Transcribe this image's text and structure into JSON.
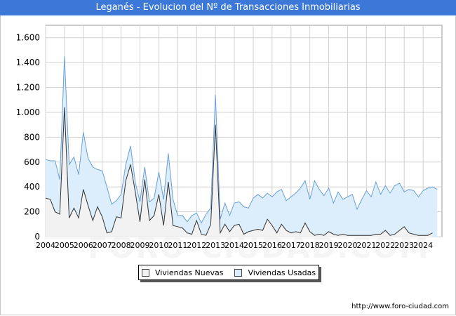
{
  "title": "Leganés - Evolucion del Nº de Transacciones Inmobiliarias",
  "footer": "http://www.foro-ciudad.com",
  "watermark": "FORO-CIUDAD.COM",
  "colors": {
    "title_bar": "#3c78d8",
    "nuevas_fill": "#f2f2f2",
    "nuevas_line": "#333333",
    "usadas_fill": "#dceefc",
    "usadas_line": "#6a9fd8"
  },
  "chart_data": {
    "type": "area",
    "title": "Leganés - Evolucion del Nº de Transacciones Inmobiliarias",
    "x_start": 2004,
    "x_step_quarter": 0.25,
    "x_ticks": [
      "2004",
      "2005",
      "2006",
      "2007",
      "2008",
      "2009",
      "2010",
      "2011",
      "2012",
      "2013",
      "2014",
      "2015",
      "2016",
      "2017",
      "2018",
      "2019",
      "2020",
      "2021",
      "2022",
      "2023",
      "2024"
    ],
    "y_ticks": [
      "0",
      "200",
      "400",
      "600",
      "800",
      "1.000",
      "1.200",
      "1.400",
      "1.600"
    ],
    "ylim": [
      0,
      1700
    ],
    "grid": true,
    "legend_position": "bottom-center",
    "series": [
      {
        "name": "Viviendas Nuevas",
        "values": [
          310,
          300,
          200,
          180,
          1040,
          150,
          230,
          150,
          380,
          250,
          130,
          240,
          160,
          30,
          40,
          160,
          150,
          450,
          580,
          360,
          120,
          460,
          130,
          170,
          340,
          90,
          440,
          90,
          80,
          70,
          30,
          20,
          130,
          20,
          10,
          100,
          900,
          30,
          100,
          40,
          90,
          100,
          20,
          40,
          50,
          60,
          50,
          140,
          90,
          30,
          100,
          50,
          30,
          40,
          30,
          110,
          40,
          10,
          20,
          10,
          40,
          20,
          10,
          20,
          10,
          10,
          10,
          10,
          10,
          10,
          20,
          20,
          50,
          10,
          20,
          50,
          80,
          30,
          20,
          10,
          10,
          10,
          30
        ],
        "legend": "Viviendas Nuevas"
      },
      {
        "name": "Viviendas Usadas",
        "values": [
          620,
          610,
          610,
          460,
          1450,
          580,
          640,
          500,
          840,
          630,
          560,
          540,
          530,
          400,
          260,
          290,
          340,
          580,
          730,
          440,
          280,
          560,
          280,
          310,
          520,
          300,
          670,
          300,
          170,
          170,
          120,
          170,
          190,
          110,
          180,
          230,
          1140,
          140,
          270,
          170,
          270,
          280,
          240,
          230,
          310,
          340,
          310,
          350,
          320,
          360,
          380,
          290,
          320,
          350,
          390,
          450,
          300,
          450,
          380,
          330,
          390,
          270,
          360,
          300,
          320,
          340,
          220,
          300,
          370,
          320,
          440,
          340,
          410,
          350,
          410,
          430,
          360,
          380,
          370,
          320,
          370,
          390,
          400,
          380
        ],
        "legend": "Viviendas Usadas"
      }
    ]
  }
}
